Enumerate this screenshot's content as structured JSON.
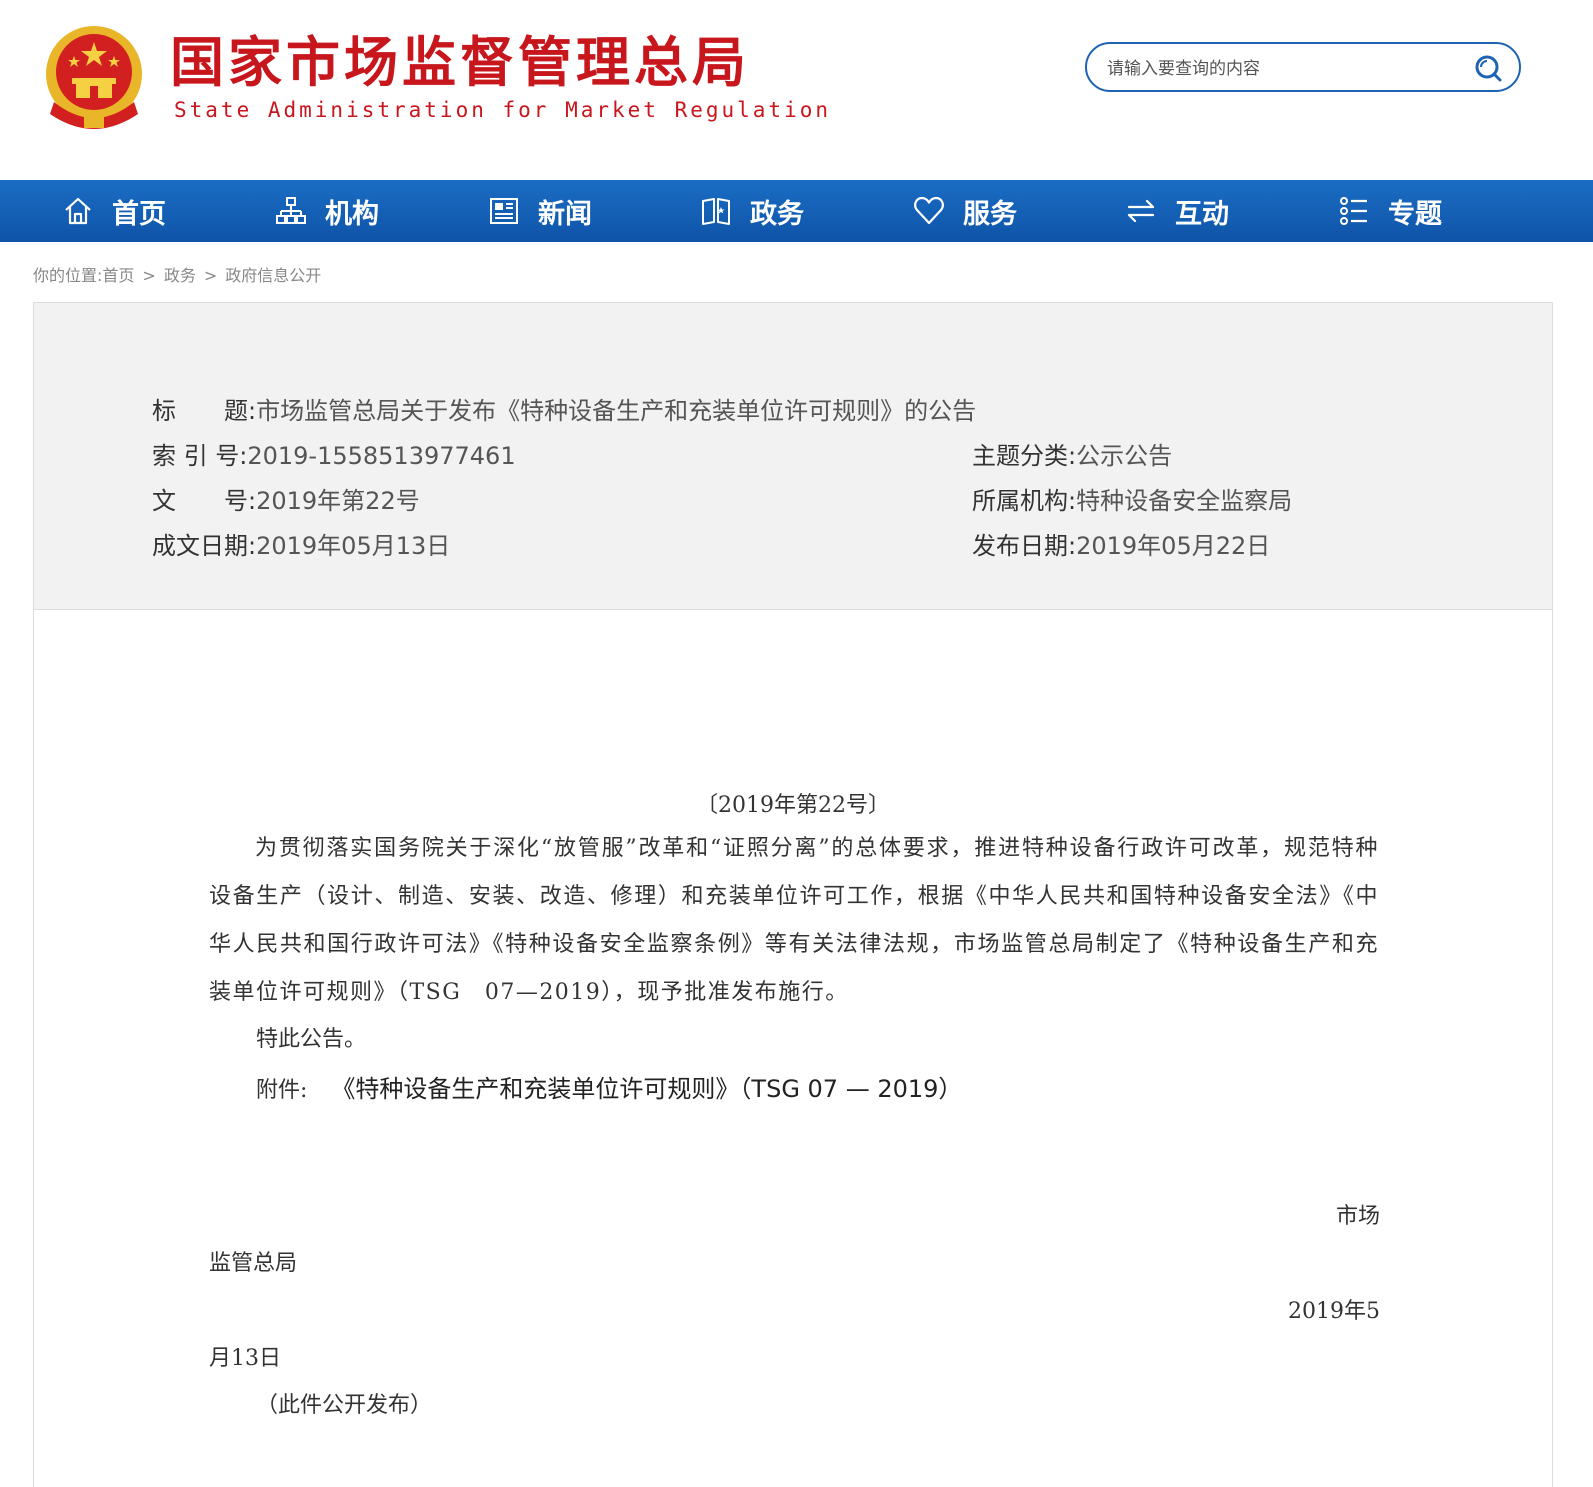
{
  "header": {
    "site_title": "国家市场监督管理总局",
    "site_subtitle": "State Administration for Market Regulation",
    "search_placeholder": "请输入要查询的内容"
  },
  "nav": {
    "items": [
      {
        "label": "首页",
        "icon": "home-icon"
      },
      {
        "label": "机构",
        "icon": "org-chart-icon"
      },
      {
        "label": "新闻",
        "icon": "news-icon"
      },
      {
        "label": "政务",
        "icon": "book-icon"
      },
      {
        "label": "服务",
        "icon": "heart-icon"
      },
      {
        "label": "互动",
        "icon": "exchange-icon"
      },
      {
        "label": "专题",
        "icon": "list-icon"
      }
    ]
  },
  "breadcrumb": {
    "prefix": "你的位置:",
    "items": [
      "首页",
      "政务",
      "政府信息公开"
    ],
    "separator": ">"
  },
  "info": {
    "title_label": "标　　题:",
    "title_value": "市场监管总局关于发布《特种设备生产和充装单位许可规则》的公告",
    "index_label": "索 引 号:",
    "index_value": "2019-1558513977461",
    "category_label": "主题分类:",
    "category_value": "公示公告",
    "docno_label": "文　　号:",
    "docno_value": "2019年第22号",
    "agency_label": "所属机构:",
    "agency_value": "特种设备安全监察局",
    "written_label": "成文日期:",
    "written_value": "2019年05月13日",
    "published_label": "发布日期:",
    "published_value": "2019年05月22日"
  },
  "body": {
    "doc_number": "〔2019年第22号〕",
    "paragraph": "为贯彻落实国务院关于深化“放管服”改革和“证照分离”的总体要求，推进特种设备行政许可改革，规范特种设备生产（设计、制造、安装、改造、修理）和充装单位许可工作，根据《中华人民共和国特种设备安全法》《中华人民共和国行政许可法》《特种设备安全监察条例》等有关法律法规，市场监管总局制定了《特种设备生产和充装单位许可规则》（TSG　07—2019），现予批准发布施行。",
    "notice": "特此公告。",
    "attachment_label": "附件:",
    "attachment_link": "《特种设备生产和充装单位许可规则》（TSG 07 — 2019）",
    "signer_line1": "市场",
    "signer_line2": "监管总局",
    "date_line1": "2019年5",
    "date_line2": "月13日",
    "publish_note": "（此件公开发布）"
  },
  "colors": {
    "brand_red": "#c8161d",
    "nav_blue": "#1a6dc4",
    "panel_gray": "#f2f2f2"
  }
}
